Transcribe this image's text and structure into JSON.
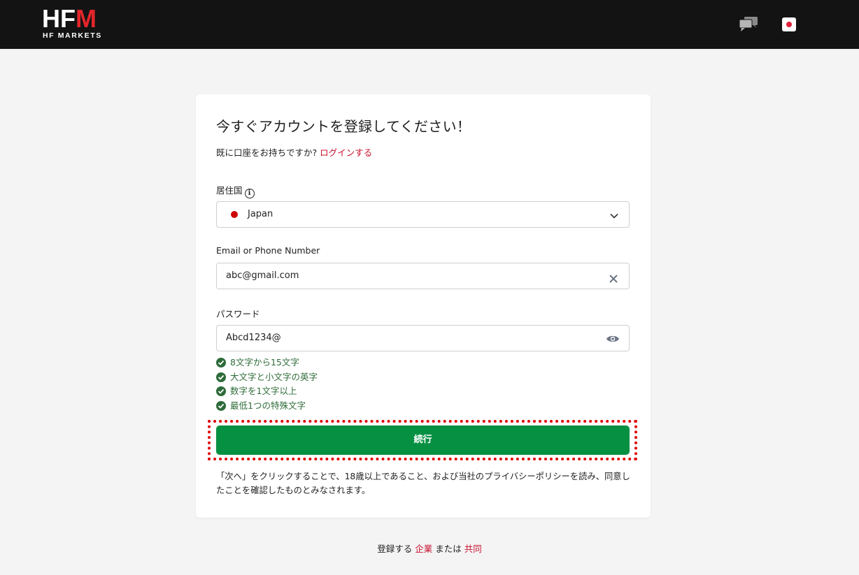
{
  "header": {
    "logo_text": "HF",
    "logo_text_m": "M",
    "logo_subtitle": "HF MARKETS",
    "chat_icon": "chat-bubbles-icon",
    "language_flag": "japan-flag-icon"
  },
  "form": {
    "title": "今すぐアカウントを登録してください！",
    "login_prompt": "既に口座をお持ちですか?",
    "login_link": "ログインする",
    "country": {
      "label": "居住国",
      "value": "Japan",
      "flag_color": "#cc0000"
    },
    "email": {
      "label": "Email or Phone Number",
      "value": "abc@gmail.com"
    },
    "password": {
      "label": "パスワード",
      "value": "Abcd1234@"
    },
    "rules": [
      "8文字から15文字",
      "大文字と小文字の英字",
      "数字を1文字以上",
      "最低1つの特殊文字"
    ],
    "continue_label": "続行",
    "disclaimer": "「次へ」をクリックすることで、18歳以上であること、および当社のプライバシーポリシーを読み、同意したことを確認したものとみなされます。"
  },
  "footer": {
    "prefix": "登録する",
    "corporate_link": "企業",
    "middle": "または",
    "joint_link": "共同"
  },
  "colors": {
    "accent_green": "#069042",
    "link_red": "#c8102e",
    "highlight_red": "#e00000",
    "check_green": "#2e6b3a"
  }
}
